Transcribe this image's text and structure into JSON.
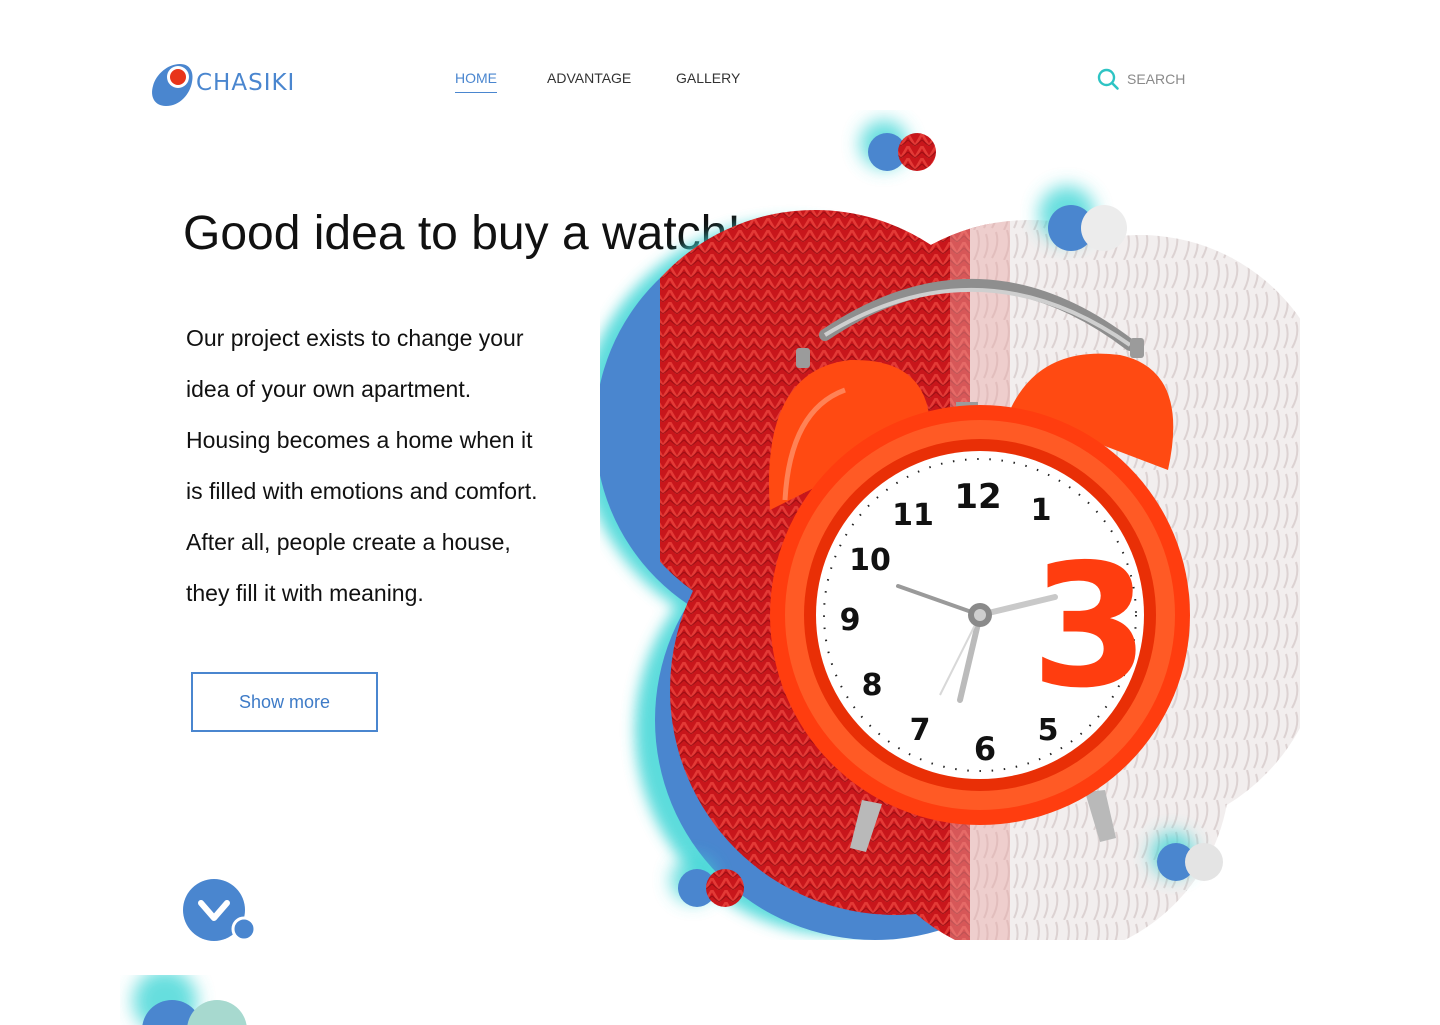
{
  "header": {
    "logo_text": "CHASIKI",
    "nav": [
      {
        "label": "HOME",
        "active": true
      },
      {
        "label": "ADVANTAGE",
        "active": false
      },
      {
        "label": "GALLERY",
        "active": false
      }
    ],
    "search_label": "SEARCH",
    "search_icon": "search-icon"
  },
  "hero": {
    "title": "Good idea to buy a watch!",
    "body_lines": [
      "Our project exists to change your",
      "idea of your own apartment.",
      "Housing becomes a home when it",
      "is filled with emotions and comfort.",
      "After all, people create a house,",
      "they fill it with meaning."
    ],
    "cta_label": "Show more",
    "scroll_icon": "chevron-down-icon"
  },
  "clock": {
    "numerals": [
      "12",
      "1",
      "3",
      "5",
      "6",
      "7",
      "8",
      "9",
      "10",
      "11"
    ]
  },
  "colors": {
    "accent_blue": "#4a86cf",
    "teal_glow": "#3fd6d6",
    "knit_red": "#c8161b",
    "clock_orange": "#ff3d0f",
    "text": "#111111"
  }
}
